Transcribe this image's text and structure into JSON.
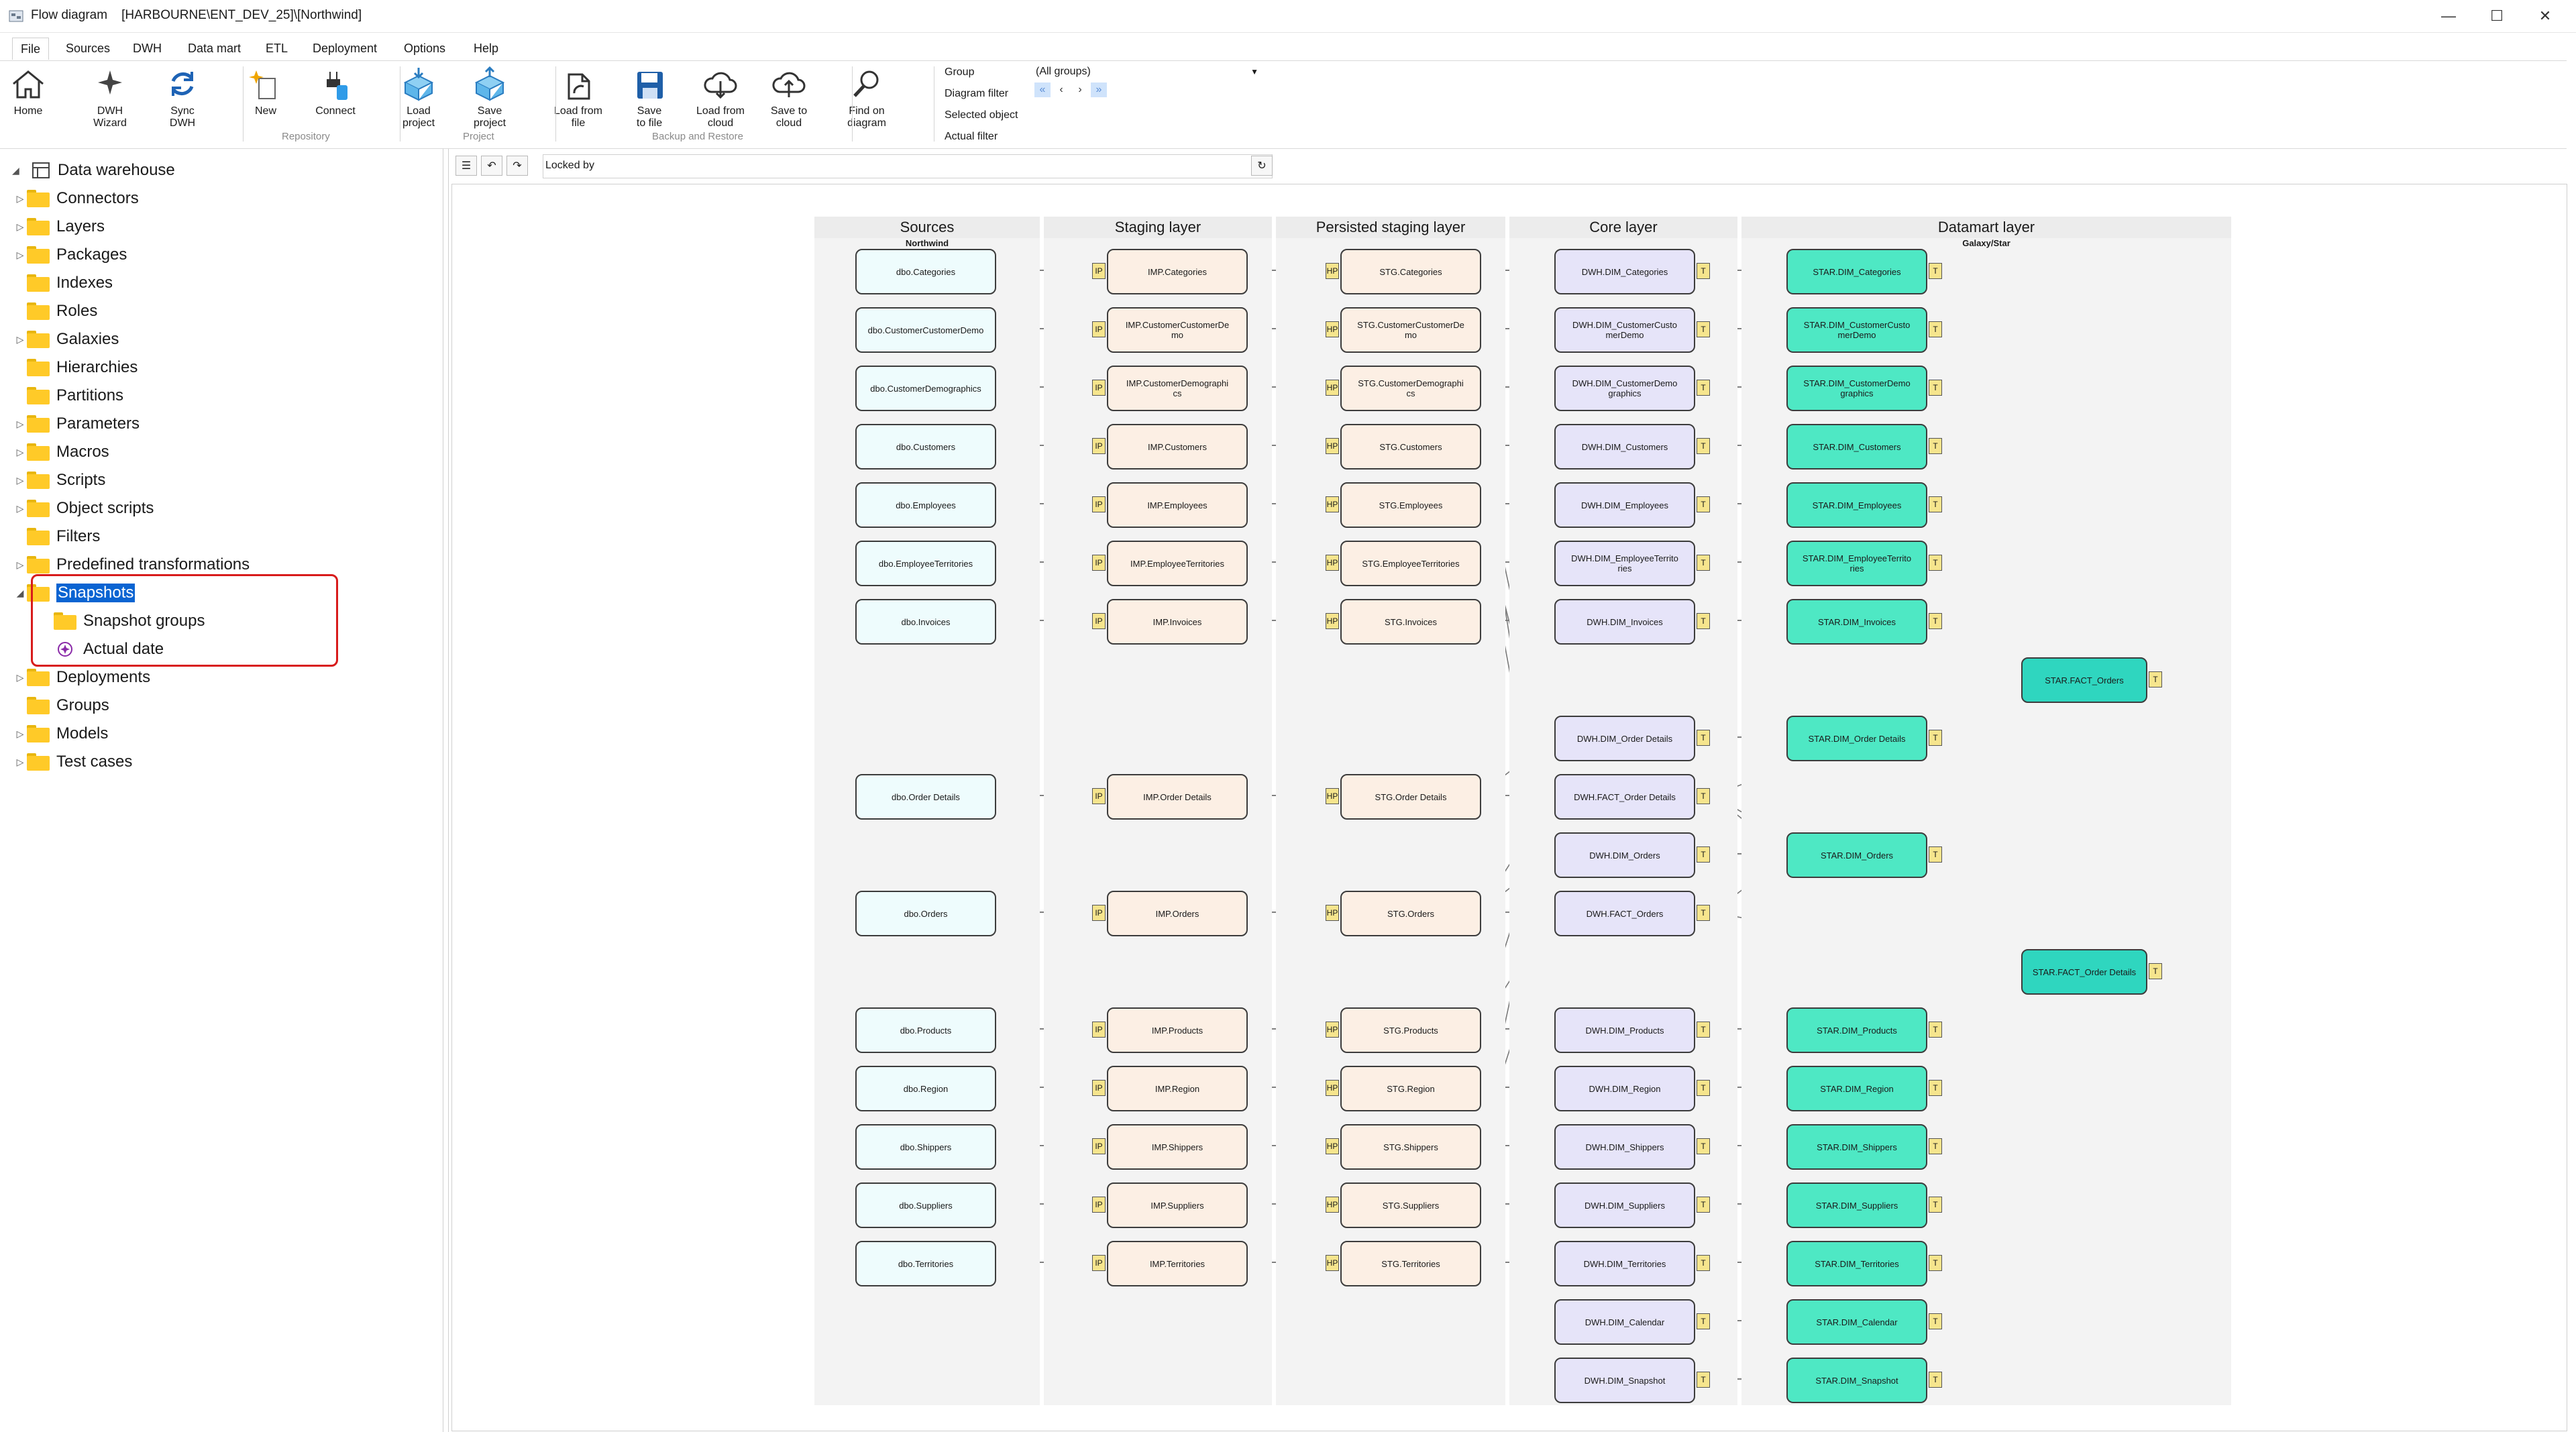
{
  "window": {
    "title": "Flow diagram    [HARBOURNE\\ENT_DEV_25]\\[Northwind]",
    "minimize": "—",
    "maximize": "☐",
    "close": "✕"
  },
  "menu": [
    "File",
    "Sources",
    "DWH",
    "Data mart",
    "ETL",
    "Deployment",
    "Options",
    "Help"
  ],
  "ribbon": {
    "buttons": [
      {
        "label": "Home",
        "icon": "home-icon"
      },
      {
        "label": "DWH\nWizard",
        "icon": "wizard-icon"
      },
      {
        "label": "Sync\nDWH",
        "icon": "sync-icon"
      },
      {
        "label": "New",
        "icon": "new-icon"
      },
      {
        "label": "Connect",
        "icon": "connect-icon"
      },
      {
        "label": "Load\nproject",
        "icon": "load-project-icon"
      },
      {
        "label": "Save\nproject",
        "icon": "save-project-icon"
      },
      {
        "label": "Load from\nfile",
        "icon": "load-file-icon"
      },
      {
        "label": "Save\nto file",
        "icon": "save-file-icon"
      },
      {
        "label": "Load from\ncloud",
        "icon": "load-cloud-icon"
      },
      {
        "label": "Save to\ncloud",
        "icon": "save-cloud-icon"
      },
      {
        "label": "Find on\ndiagram",
        "icon": "find-icon"
      }
    ],
    "groups": [
      "Repository",
      "Project",
      "Backup and Restore"
    ],
    "filters": {
      "group_label": "Group",
      "group_value": "(All groups)",
      "diagram_filter_label": "Diagram filter",
      "selected_object_label": "Selected object",
      "actual_filter_label": "Actual filter",
      "nav": [
        "«",
        "‹",
        "›",
        "»"
      ]
    }
  },
  "tree": {
    "root": "Data warehouse",
    "items": [
      {
        "label": "Connectors",
        "exp": "▷",
        "level": 1
      },
      {
        "label": "Layers",
        "exp": "▷",
        "level": 1
      },
      {
        "label": "Packages",
        "exp": "▷",
        "level": 1
      },
      {
        "label": "Indexes",
        "exp": "",
        "level": 1
      },
      {
        "label": "Roles",
        "exp": "",
        "level": 1
      },
      {
        "label": "Galaxies",
        "exp": "▷",
        "level": 1
      },
      {
        "label": "Hierarchies",
        "exp": "",
        "level": 1
      },
      {
        "label": "Partitions",
        "exp": "",
        "level": 1
      },
      {
        "label": "Parameters",
        "exp": "▷",
        "level": 1
      },
      {
        "label": "Macros",
        "exp": "▷",
        "level": 1
      },
      {
        "label": "Scripts",
        "exp": "▷",
        "level": 1
      },
      {
        "label": "Object scripts",
        "exp": "▷",
        "level": 1
      },
      {
        "label": "Filters",
        "exp": "",
        "level": 1
      },
      {
        "label": "Predefined transformations",
        "exp": "▷",
        "level": 1
      },
      {
        "label": "Snapshots",
        "exp": "◢",
        "level": 1,
        "selected": true
      },
      {
        "label": "Snapshot groups",
        "exp": "",
        "level": 2
      },
      {
        "label": "Actual date",
        "exp": "",
        "level": 2,
        "special": true
      },
      {
        "label": "Deployments",
        "exp": "▷",
        "level": 1
      },
      {
        "label": "Groups",
        "exp": "",
        "level": 1
      },
      {
        "label": "Models",
        "exp": "▷",
        "level": 1
      },
      {
        "label": "Test cases",
        "exp": "▷",
        "level": 1
      }
    ]
  },
  "diagram": {
    "locked_by": "Locked by",
    "layers": [
      {
        "name": "Sources",
        "sub": "Northwind"
      },
      {
        "name": "Staging layer",
        "sub": ""
      },
      {
        "name": "Persisted staging layer",
        "sub": ""
      },
      {
        "name": "Core layer",
        "sub": ""
      },
      {
        "name": "Datamart layer",
        "sub": "Galaxy/Star"
      }
    ],
    "tags": {
      "imp": "IP",
      "stg": "HP",
      "dwh": "T",
      "star": "T"
    },
    "rows": [
      {
        "src": "dbo.Categories",
        "imp": "IMP.Categories",
        "stg": "STG.Categories",
        "dwh": "DWH.DIM_Categories",
        "star": "STAR.DIM_Categories"
      },
      {
        "src": "dbo.CustomerCustomerDemo",
        "imp": "IMP.CustomerCustomerDe\nmo",
        "stg": "STG.CustomerCustomerDe\nmo",
        "dwh": "DWH.DIM_CustomerCusto\nmerDemo",
        "star": "STAR.DIM_CustomerCusto\nmerDemo"
      },
      {
        "src": "dbo.CustomerDemographics",
        "imp": "IMP.CustomerDemographi\ncs",
        "stg": "STG.CustomerDemographi\ncs",
        "dwh": "DWH.DIM_CustomerDemo\ngraphics",
        "star": "STAR.DIM_CustomerDemo\ngraphics"
      },
      {
        "src": "dbo.Customers",
        "imp": "IMP.Customers",
        "stg": "STG.Customers",
        "dwh": "DWH.DIM_Customers",
        "star": "STAR.DIM_Customers"
      },
      {
        "src": "dbo.Employees",
        "imp": "IMP.Employees",
        "stg": "STG.Employees",
        "dwh": "DWH.DIM_Employees",
        "star": "STAR.DIM_Employees"
      },
      {
        "src": "dbo.EmployeeTerritories",
        "imp": "IMP.EmployeeTerritories",
        "stg": "STG.EmployeeTerritories",
        "dwh": "DWH.DIM_EmployeeTerrito\nries",
        "star": "STAR.DIM_EmployeeTerrito\nries"
      },
      {
        "src": "dbo.Invoices",
        "imp": "IMP.Invoices",
        "stg": "STG.Invoices",
        "dwh": "DWH.DIM_Invoices",
        "star": "STAR.DIM_Invoices"
      },
      {
        "src": "",
        "imp": "",
        "stg": "",
        "dwh": "",
        "star": "",
        "fact": "STAR.FACT_Orders"
      },
      {
        "src": "",
        "imp": "",
        "stg": "",
        "dwh": "DWH.DIM_Order Details",
        "star": "STAR.DIM_Order Details"
      },
      {
        "src": "dbo.Order Details",
        "imp": "IMP.Order Details",
        "stg": "STG.Order Details",
        "dwh": "DWH.FACT_Order Details",
        "star": ""
      },
      {
        "src": "",
        "imp": "",
        "stg": "",
        "dwh": "DWH.DIM_Orders",
        "star": "STAR.DIM_Orders"
      },
      {
        "src": "dbo.Orders",
        "imp": "IMP.Orders",
        "stg": "STG.Orders",
        "dwh": "DWH.FACT_Orders",
        "star": ""
      },
      {
        "src": "",
        "imp": "",
        "stg": "",
        "dwh": "",
        "star": "",
        "fact": "STAR.FACT_Order Details"
      },
      {
        "src": "dbo.Products",
        "imp": "IMP.Products",
        "stg": "STG.Products",
        "dwh": "DWH.DIM_Products",
        "star": "STAR.DIM_Products"
      },
      {
        "src": "dbo.Region",
        "imp": "IMP.Region",
        "stg": "STG.Region",
        "dwh": "DWH.DIM_Region",
        "star": "STAR.DIM_Region"
      },
      {
        "src": "dbo.Shippers",
        "imp": "IMP.Shippers",
        "stg": "STG.Shippers",
        "dwh": "DWH.DIM_Shippers",
        "star": "STAR.DIM_Shippers"
      },
      {
        "src": "dbo.Suppliers",
        "imp": "IMP.Suppliers",
        "stg": "STG.Suppliers",
        "dwh": "DWH.DIM_Suppliers",
        "star": "STAR.DIM_Suppliers"
      },
      {
        "src": "dbo.Territories",
        "imp": "IMP.Territories",
        "stg": "STG.Territories",
        "dwh": "DWH.DIM_Territories",
        "star": "STAR.DIM_Territories"
      },
      {
        "src": "",
        "imp": "",
        "stg": "",
        "dwh": "DWH.DIM_Calendar",
        "star": "STAR.DIM_Calendar"
      },
      {
        "src": "",
        "imp": "",
        "stg": "",
        "dwh": "DWH.DIM_Snapshot",
        "star": "STAR.DIM_Snapshot"
      }
    ],
    "colors": {
      "src": "#eefcfd",
      "imp": "#fcefe4",
      "stg": "#fcefe4",
      "dwh": "#e6e4f9",
      "star": "#4ee8c4",
      "fact": "#2fd6bf",
      "highlight": "#d81b1b",
      "accent": "#0a64d2"
    }
  }
}
